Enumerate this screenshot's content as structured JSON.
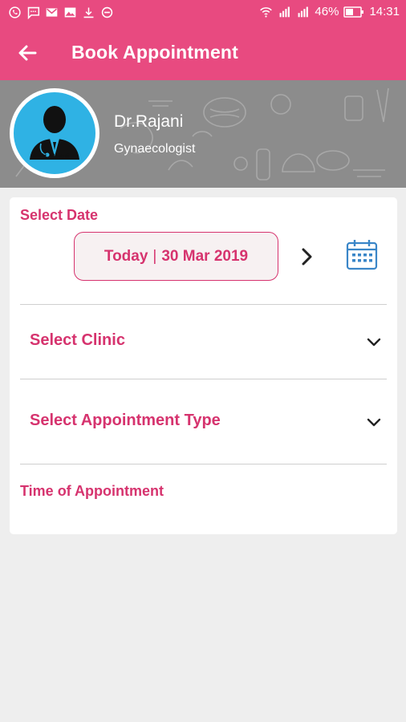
{
  "status_bar": {
    "battery": "46%",
    "time": "14:31"
  },
  "app_bar": {
    "title": "Book Appointment"
  },
  "doctor": {
    "name": "Dr.Rajani",
    "specialty": "Gynaecologist",
    "avatar_caption": "Dr. Rajani"
  },
  "form": {
    "select_date_label": "Select Date",
    "date_prefix": "Today",
    "date_separator": "|",
    "date_value": "30 Mar 2019",
    "clinic_label": "Select Clinic",
    "appointment_type_label": "Select Appointment Type",
    "time_label": "Time of Appointment"
  },
  "colors": {
    "accent": "#e84a80",
    "label": "#d6336e",
    "avatar_bg": "#2fb2e4",
    "calendar_icon": "#3a86c8"
  },
  "icons": [
    "whatsapp-icon",
    "message-icon",
    "gmail-icon",
    "gallery-icon",
    "download-icon",
    "dnd-icon",
    "wifi-icon",
    "signal-icon",
    "battery-icon",
    "back-arrow-icon",
    "chevron-right-icon",
    "calendar-icon",
    "chevron-down-icon"
  ]
}
